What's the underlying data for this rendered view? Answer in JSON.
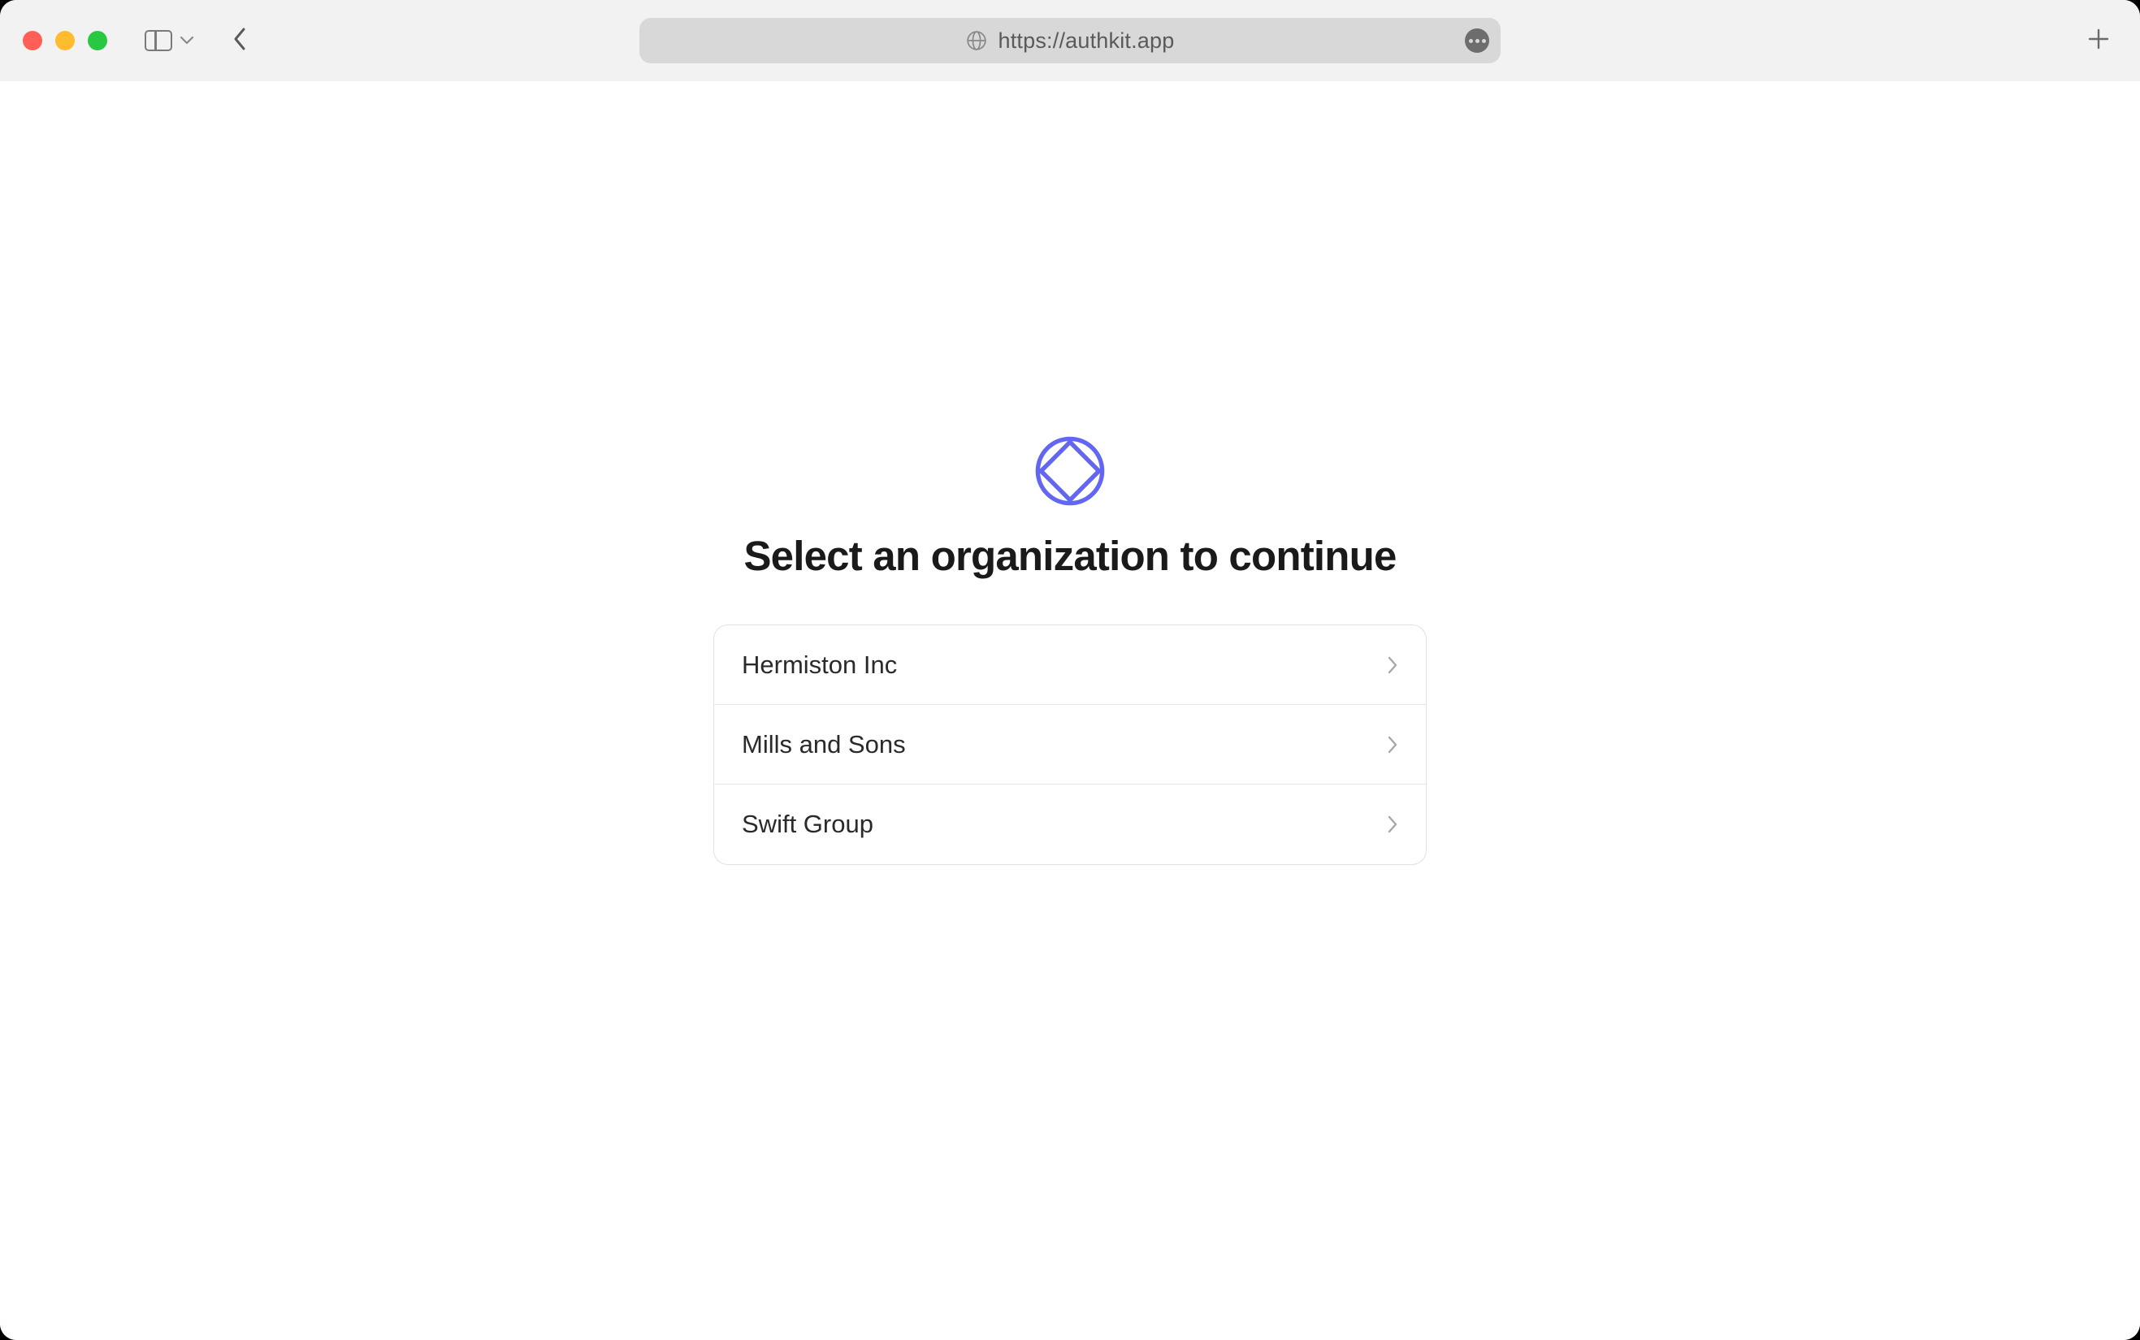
{
  "browser": {
    "url": "https://authkit.app"
  },
  "page": {
    "heading": "Select an organization to continue",
    "organizations": [
      {
        "name": "Hermiston Inc"
      },
      {
        "name": "Mills and Sons"
      },
      {
        "name": "Swift Group"
      }
    ]
  },
  "colors": {
    "accent": "#6366f1"
  }
}
